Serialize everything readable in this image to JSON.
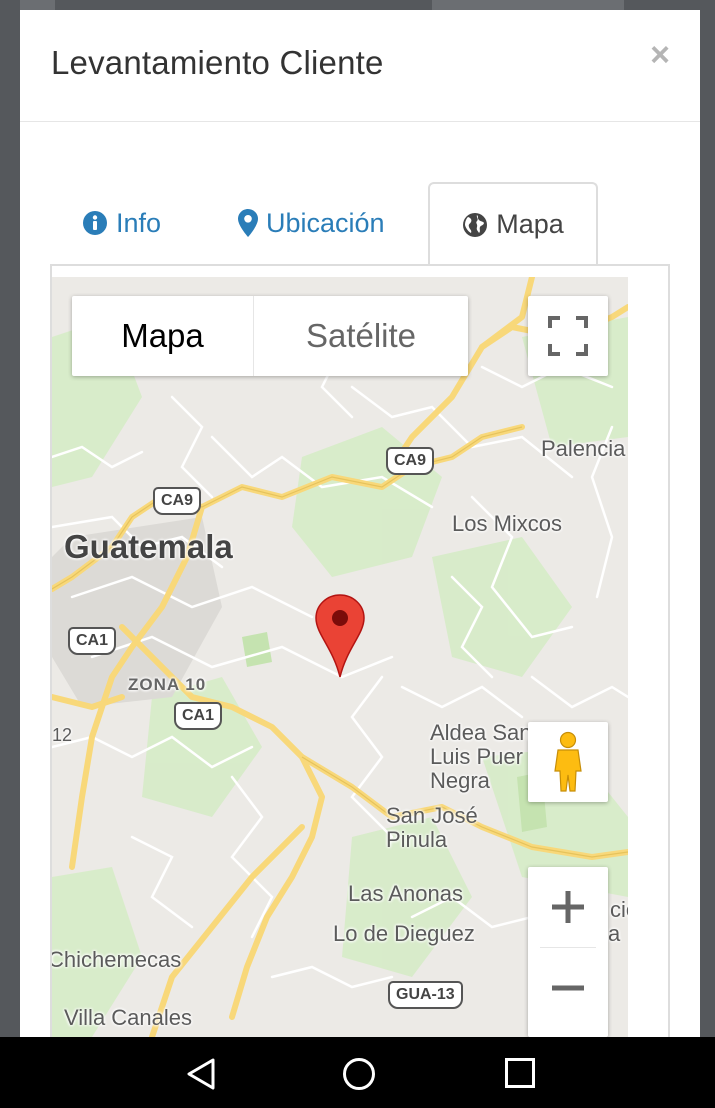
{
  "modal": {
    "title": "Levantamiento Cliente",
    "close_label": "×"
  },
  "tabs": [
    {
      "label": "Info",
      "icon": "info-circle-icon"
    },
    {
      "label": "Ubicación",
      "icon": "map-marker-icon"
    },
    {
      "label": "Mapa",
      "icon": "globe-icon",
      "active": true
    }
  ],
  "map": {
    "type_control": {
      "map_label": "Mapa",
      "satellite_label": "Satélite",
      "selected": "Mapa"
    },
    "places": {
      "guatemala": "Guatemala",
      "palencia": "Palencia",
      "los_mixcos": "Los Mixcos",
      "zona10": "ZONA 10",
      "aldea": "Aldea San\nLuis Puer\nNegra",
      "san_jose": "San José\nPinula",
      "las_anonas": "Las Anonas",
      "lo_de_dieguez": "Lo de Dieguez",
      "chichemecas": "Chichemecas",
      "villa_canales": "Villa Canales",
      "edge_12": "12",
      "edge_cio": "cio",
      "edge_a": "a"
    },
    "routes": {
      "ca9_north": "CA9",
      "ca9_west": "CA9",
      "ca1_west": "CA1",
      "ca1_south": "CA1",
      "gua13": "GUA-13"
    },
    "colors": {
      "land": "#eceae6",
      "park": "#d6ecc7",
      "highway": "#f8d87a",
      "road": "#ffffff",
      "marker": "#ea4335"
    }
  },
  "navbar": {
    "back": "back-icon",
    "home": "home-icon",
    "recents": "recents-icon"
  }
}
